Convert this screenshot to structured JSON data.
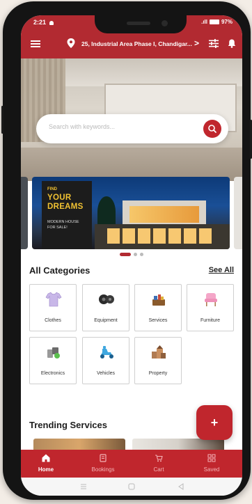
{
  "status": {
    "time": "2:21",
    "battery": "97%"
  },
  "header": {
    "address": "25, Industrial Area Phase I, Chandigar...",
    "chevron": ">"
  },
  "search": {
    "placeholder": "Search with keywords..."
  },
  "banner": {
    "find": "FIND",
    "line1": "YOUR",
    "line2": "DREAMS",
    "sub1": "MODERN HOUSE",
    "sub2": "FOR SALE!"
  },
  "carousel": {
    "slides": 3,
    "active_index": 0
  },
  "categories": {
    "title": "All Categories",
    "see_all": "See All",
    "items": [
      {
        "label": "Clothes",
        "icon": "clothes-icon"
      },
      {
        "label": "Equipment",
        "icon": "equipment-icon"
      },
      {
        "label": "Services",
        "icon": "services-icon"
      },
      {
        "label": "Furniture",
        "icon": "furniture-icon"
      },
      {
        "label": "Electronics",
        "icon": "electronics-icon"
      },
      {
        "label": "Vehicles",
        "icon": "vehicles-icon"
      },
      {
        "label": "Property",
        "icon": "property-icon"
      }
    ]
  },
  "trending": {
    "title": "Trending Services"
  },
  "fab": {
    "label": "+"
  },
  "nav": {
    "items": [
      {
        "label": "Home",
        "icon": "home-icon",
        "active": true
      },
      {
        "label": "Bookings",
        "icon": "bookings-icon",
        "active": false
      },
      {
        "label": "Cart",
        "icon": "cart-icon",
        "active": false
      },
      {
        "label": "Saved",
        "icon": "saved-icon",
        "active": false
      }
    ]
  },
  "colors": {
    "brand": "#b22a31",
    "banner_text": "#f1c232"
  }
}
